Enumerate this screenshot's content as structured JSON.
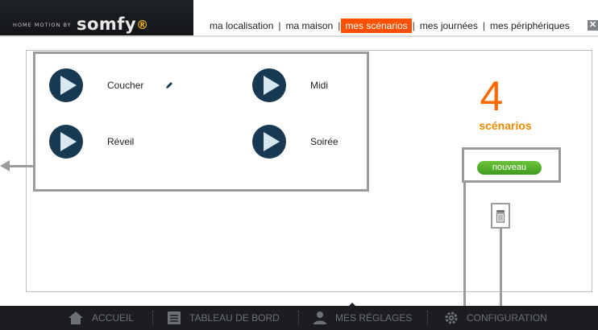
{
  "header": {
    "tagline": "HOME MOTION BY",
    "brand": "somfy",
    "brand_mark": "®",
    "nav": [
      {
        "label": "ma localisation"
      },
      {
        "label": "ma maison"
      },
      {
        "label": "mes scénarios",
        "active": true
      },
      {
        "label": "mes journées"
      },
      {
        "label": "mes périphériques"
      }
    ],
    "close": "✕"
  },
  "scenarios": [
    {
      "label": "Coucher"
    },
    {
      "label": "Midi"
    },
    {
      "label": "Réveil"
    },
    {
      "label": "Soirée"
    }
  ],
  "summary": {
    "count": "4",
    "label": "scénarios"
  },
  "actions": {
    "new_label": "nouveau"
  },
  "footer": [
    {
      "label": "ACCUEIL",
      "icon": "home-icon"
    },
    {
      "label": "TABLEAU DE BORD",
      "icon": "dashboard-icon"
    },
    {
      "label": "MES RÉGLAGES",
      "icon": "user-icon"
    },
    {
      "label": "CONFIGURATION",
      "icon": "gear-icon"
    }
  ],
  "colors": {
    "accent": "#ff4f00",
    "count": "#ff6a00",
    "play": "#173a52",
    "new_button": "#4fae28",
    "highlight": "#9b9b9b"
  }
}
